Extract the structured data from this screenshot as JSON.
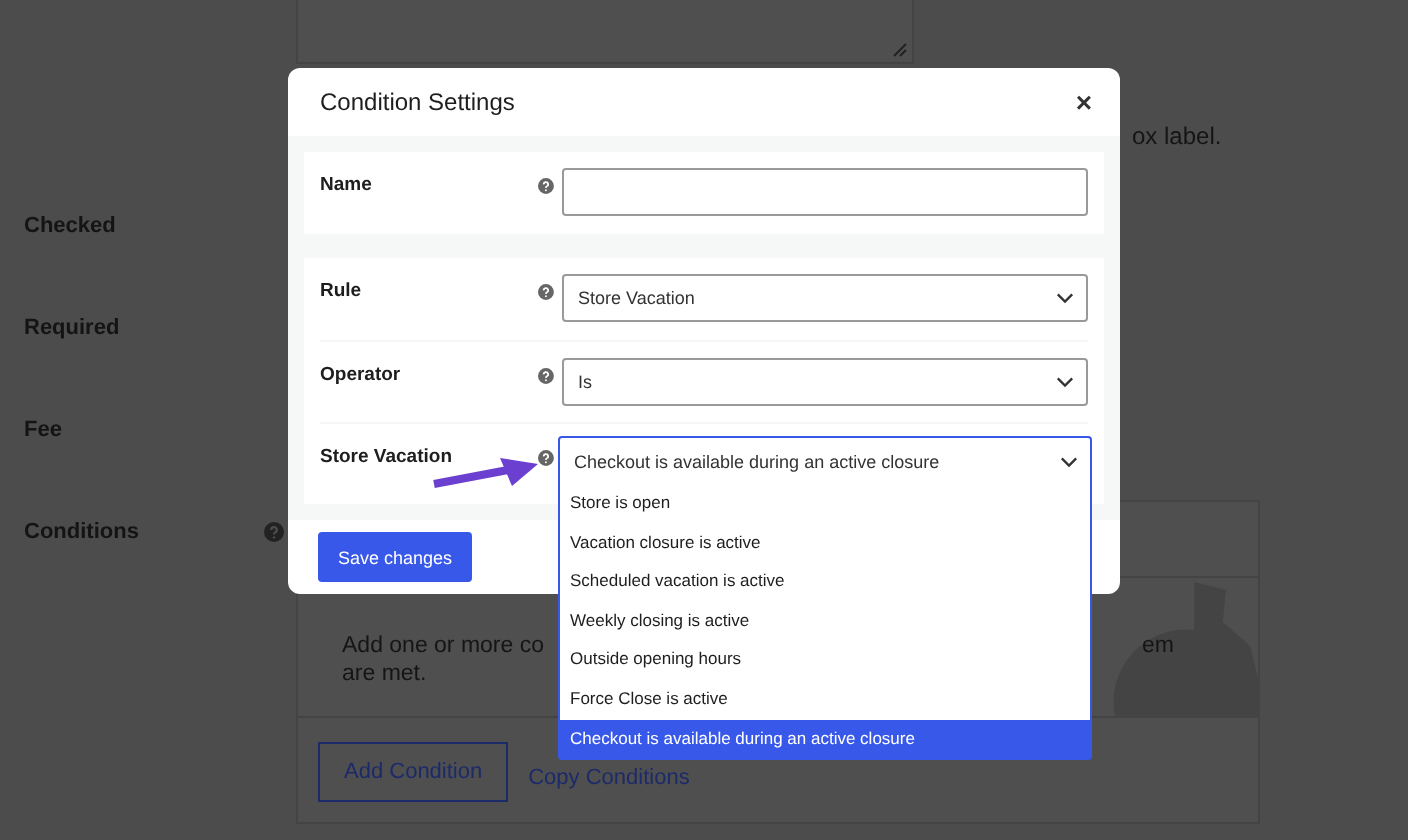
{
  "background_page": {
    "cut_text": "ox label.",
    "fields": [
      {
        "label": "Checked"
      },
      {
        "label": "Required"
      },
      {
        "label": "Fee"
      },
      {
        "label": "Conditions",
        "help": true
      }
    ],
    "conditions_box": {
      "text_start": "Add one or more co",
      "text_end": "em",
      "text_line_2": "are met.",
      "buttons": [
        "Add Condition",
        "Copy Conditions"
      ]
    }
  },
  "modal": {
    "title": "Condition Settings",
    "close": "×",
    "sections": [
      [
        {
          "label": "Name",
          "kind": "text"
        }
      ],
      [
        {
          "label": "Rule",
          "kind": "select",
          "value": "Store Vacation"
        },
        {
          "label": "Operator",
          "kind": "select",
          "value": "Is"
        },
        {
          "label": "Store Vacation",
          "kind": "open-select",
          "value": "Checkout is available during an active closure"
        }
      ]
    ],
    "save_button": "Save changes"
  },
  "dropdown": {
    "options": [
      {
        "label": "Store is open",
        "selected": false
      },
      {
        "label": "Vacation closure is active",
        "selected": false
      },
      {
        "label": "Scheduled vacation is active",
        "selected": false
      },
      {
        "label": "Weekly closing is active",
        "selected": false
      },
      {
        "label": "Outside opening hours",
        "selected": false
      },
      {
        "label": "Force Close is active",
        "selected": false
      },
      {
        "label": "Checkout is available during an active closure",
        "selected": true
      }
    ]
  }
}
